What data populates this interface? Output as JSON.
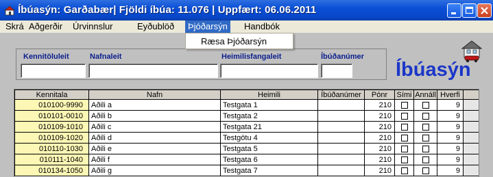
{
  "window": {
    "title": "Íbúasýn: Garðabær| Fjöldi íbúa: 11.076 | Uppfært: 06.06.2011"
  },
  "menu": {
    "items": [
      "Skrá",
      "Aðgerðir",
      "Úrvinnslur",
      "Eyðublöð",
      "Þjóðarsýn",
      "Handbók"
    ],
    "active_index": 4,
    "dropdown_item": "Ræsa Þjóðarsýn"
  },
  "search": {
    "kennitala_label": "Kennitöluleit",
    "nafn_label": "Nafnaleit",
    "heimili_label": "Heimilisfangaleit",
    "ibud_label": "Íbúðanúmer",
    "kennitala_value": "",
    "nafn_value": "",
    "heimili_value": "",
    "ibud_value": ""
  },
  "app_title": "Íbúasýn",
  "table": {
    "columns": [
      "Kennitala",
      "Nafn",
      "Heimili",
      "Íbúðanúmer",
      "Pónr",
      "Sími",
      "Annáll",
      "Hverfi"
    ],
    "rows": [
      {
        "kennitala": "010100-9990",
        "nafn": "Aðili a",
        "heimili": "Testgata 1",
        "ibud": "",
        "ponr": "210",
        "hverfi": "9"
      },
      {
        "kennitala": "010101-0010",
        "nafn": "Aðili b",
        "heimili": "Testgata 2",
        "ibud": "",
        "ponr": "210",
        "hverfi": "9"
      },
      {
        "kennitala": "010109-1010",
        "nafn": "Aðili c",
        "heimili": "Testgata 21",
        "ibud": "",
        "ponr": "210",
        "hverfi": "9"
      },
      {
        "kennitala": "010109-1020",
        "nafn": "Aðili d",
        "heimili": "Testgötu 4",
        "ibud": "",
        "ponr": "210",
        "hverfi": "9"
      },
      {
        "kennitala": "010110-1030",
        "nafn": "Aðili e",
        "heimili": "Testgata 5",
        "ibud": "",
        "ponr": "210",
        "hverfi": "9"
      },
      {
        "kennitala": "010111-1040",
        "nafn": "Aðili f",
        "heimili": "Testgata 6",
        "ibud": "",
        "ponr": "210",
        "hverfi": "9"
      },
      {
        "kennitala": "010134-1050",
        "nafn": "Aðili g",
        "heimili": "Testgata 7",
        "ibud": "",
        "ponr": "210",
        "hverfi": "9"
      }
    ]
  },
  "colors": {
    "titlebar": "#0a4fd6",
    "menu_highlight": "#316ac5",
    "label_blue": "#0a1e8c",
    "app_title_blue": "#1a36c8",
    "kennitala_cell": "#fdf7b5"
  }
}
